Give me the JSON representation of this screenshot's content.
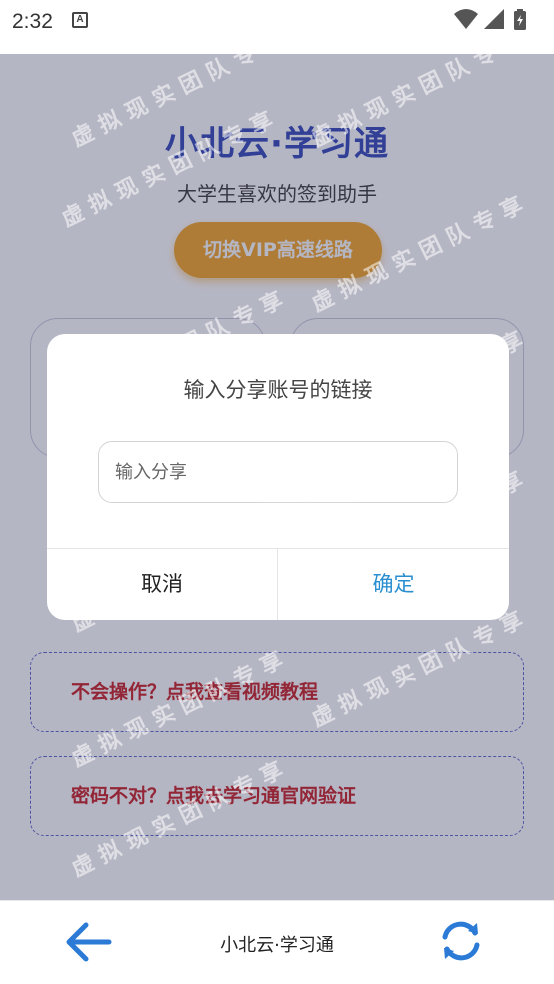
{
  "status_bar": {
    "time": "2:32",
    "notification_icon": "A",
    "icons": [
      "wifi-icon",
      "signal-icon",
      "battery-charging-icon"
    ]
  },
  "app": {
    "title": "小北云·学习通",
    "subtitle": "大学生喜欢的签到助手",
    "vip_button": "切换VIP高速线路",
    "help_video": "不会操作？点我查看视频教程",
    "help_password": "密码不对？点我去学习通官网验证"
  },
  "watermark": "虚拟现实团队专享",
  "dialog": {
    "title": "输入分享账号的链接",
    "input_placeholder": "输入分享",
    "cancel": "取消",
    "confirm": "确定"
  },
  "bottom_bar": {
    "title": "小北云·学习通"
  },
  "colors": {
    "title_blue": "#2a3fb5",
    "vip_orange": "#f4a21a",
    "help_red": "#c8181b",
    "confirm_blue": "#2a8fd0",
    "icon_blue": "#2a7ad6"
  }
}
